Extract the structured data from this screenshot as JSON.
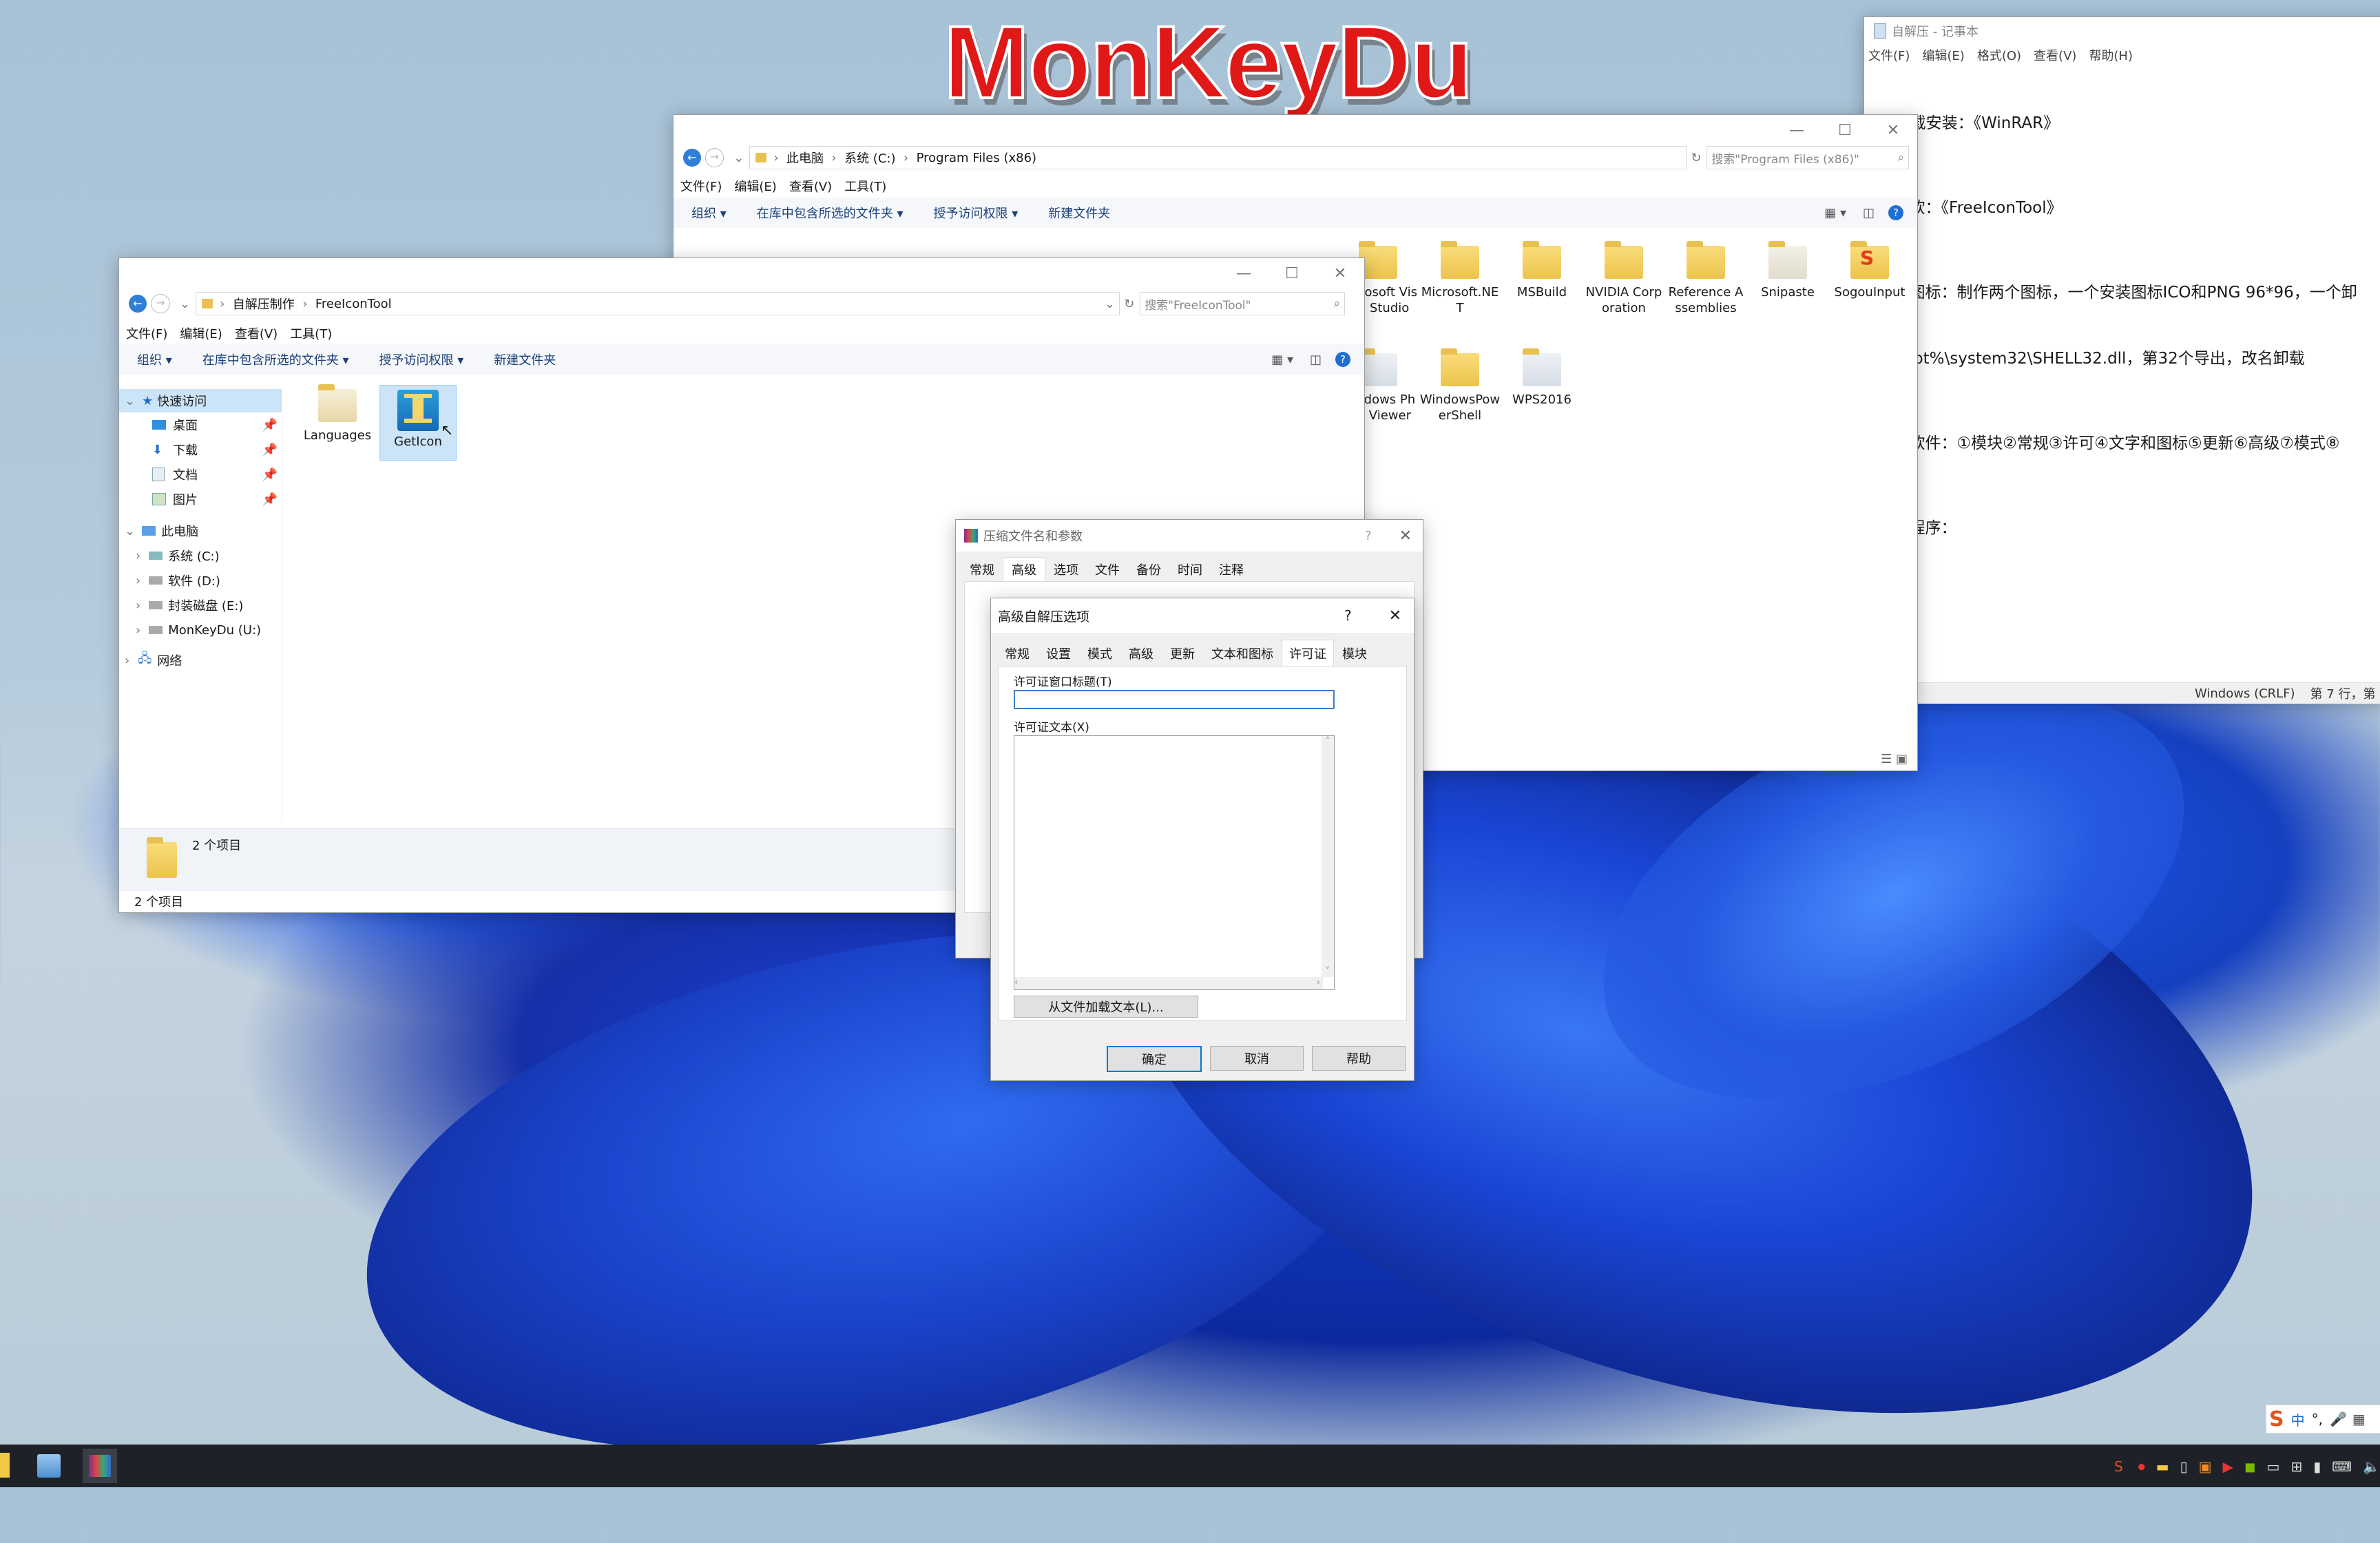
{
  "watermark": "MonKeyDu",
  "notepad": {
    "title": "自解压 - 记事本",
    "menu": [
      "文件(F)",
      "编辑(E)",
      "格式(O)",
      "查看(V)",
      "帮助(H)"
    ],
    "lines": [
      "1、下载安装：《WinRAR》",
      "     绿软：《FreeIconTool》",
      "     作图标：制作两个图标，一个安装图标ICO和PNG 96*96，一个卸",
      "emRoot%\\system32\\SHELL32.dll，第32个导出，改名卸载",
      "     的软件：①模块②常规③许可④文字和图标⑤更新⑥高级⑦模式⑧",
      "     载程序："
    ],
    "status_encoding": "Windows (CRLF)",
    "status_pos": "第 7 行，第 1"
  },
  "explorer_back": {
    "path": [
      "此电脑",
      "系统 (C:)",
      "Program Files (x86)"
    ],
    "search_placeholder": "搜索\"Program Files (x86)\"",
    "menu": [
      "文件(F)",
      "编辑(E)",
      "查看(V)",
      "工具(T)"
    ],
    "ribbon": [
      "组织 ▾",
      "在库中包含所选的文件夹 ▾",
      "授予访问权限 ▾",
      "新建文件夹"
    ],
    "items": [
      "Microsoft Visual Studio",
      "Microsoft.NET",
      "MSBuild",
      "NVIDIA Corporation",
      "Reference Assemblies",
      "Snipaste",
      "SogouInput",
      "Windows Photo Viewer",
      "WindowsPowerShell",
      "WPS2016"
    ]
  },
  "explorer_front": {
    "path": [
      "自解压制作",
      "FreeIconTool"
    ],
    "search_placeholder": "搜索\"FreeIconTool\"",
    "menu": [
      "文件(F)",
      "编辑(E)",
      "查看(V)",
      "工具(T)"
    ],
    "ribbon": [
      "组织 ▾",
      "在库中包含所选的文件夹 ▾",
      "授予访问权限 ▾",
      "新建文件夹"
    ],
    "nav": {
      "quick_access": "快速访问",
      "quick_items": [
        "桌面",
        "下载",
        "文档",
        "图片"
      ],
      "this_pc": "此电脑",
      "drives": [
        "系统 (C:)",
        "软件 (D:)",
        "封装磁盘 (E:)",
        "MonKeyDu (U:)"
      ],
      "network": "网络"
    },
    "files": [
      "Languages",
      "GetIcon"
    ],
    "details_count": "2 个项目",
    "status": "2 个项目"
  },
  "rar_dialog": {
    "title": "压缩文件名和参数",
    "tabs": [
      "常规",
      "高级",
      "选项",
      "文件",
      "备份",
      "时间",
      "注释"
    ],
    "active_tab": "高级"
  },
  "sfx_dialog": {
    "title": "高级自解压选项",
    "help_glyph": "?",
    "tabs": [
      "常规",
      "设置",
      "模式",
      "高级",
      "更新",
      "文本和图标",
      "许可证",
      "模块"
    ],
    "active_tab": "许可证",
    "license_title_label": "许可证窗口标题(T)",
    "license_title_value": "",
    "license_text_label": "许可证文本(X)",
    "license_text_value": "",
    "load_button": "从文件加载文本(L)...",
    "ok": "确定",
    "cancel": "取消",
    "help": "帮助"
  },
  "tray": {
    "ime": "中"
  }
}
